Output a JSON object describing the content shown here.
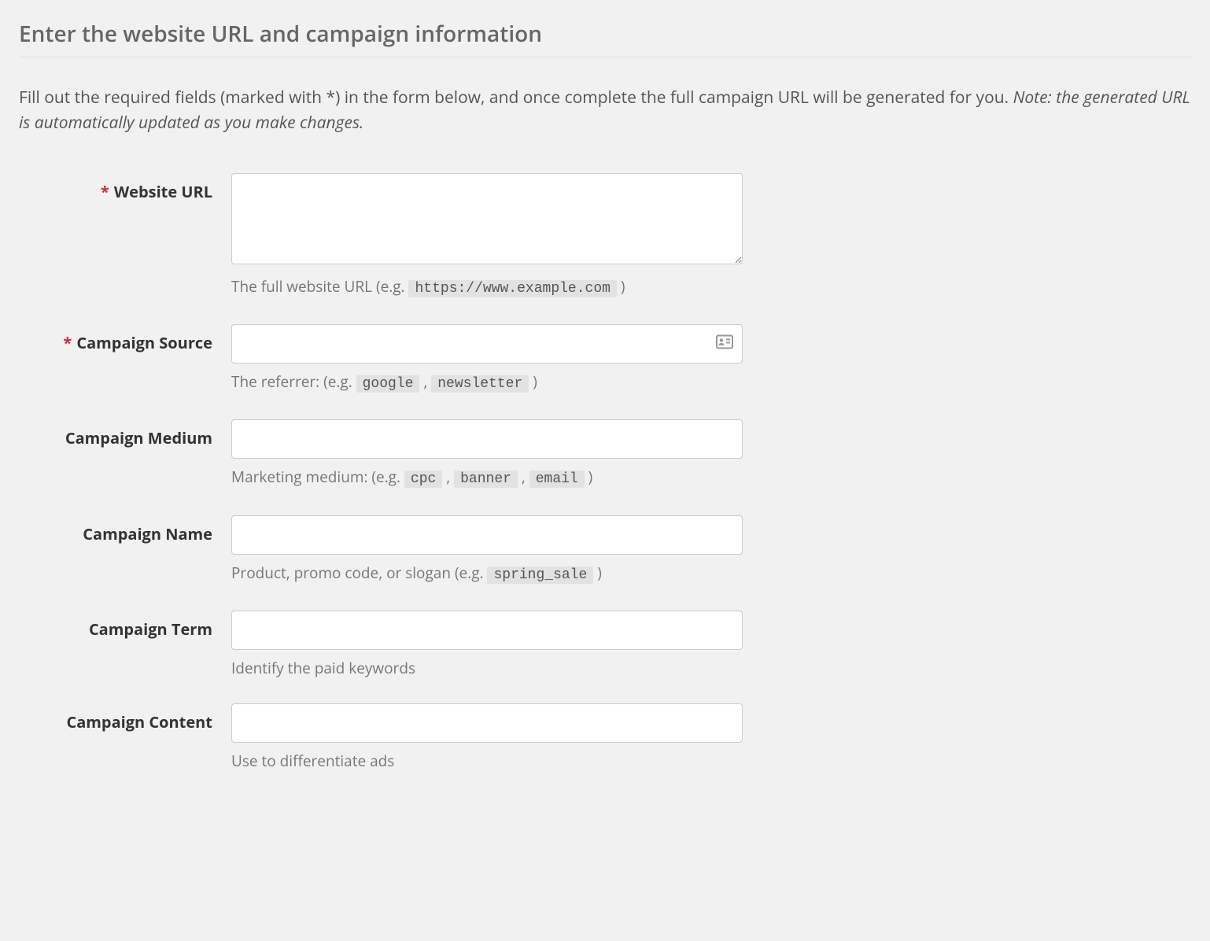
{
  "title": "Enter the website URL and campaign information",
  "intro": {
    "text": "Fill out the required fields (marked with *) in the form below, and once complete the full campaign URL will be generated for you. ",
    "note": "Note: the generated URL is automatically updated as you make changes."
  },
  "fields": {
    "website_url": {
      "label": "Website URL",
      "required": true,
      "helper_prefix": "The full website URL (e.g. ",
      "helper_code1": "https://www.example.com",
      "helper_suffix": " )"
    },
    "campaign_source": {
      "label": "Campaign Source",
      "required": true,
      "helper_prefix": "The referrer: (e.g. ",
      "helper_code1": "google",
      "helper_mid1": " , ",
      "helper_code2": "newsletter",
      "helper_suffix": " )"
    },
    "campaign_medium": {
      "label": "Campaign Medium",
      "required": false,
      "helper_prefix": "Marketing medium: (e.g. ",
      "helper_code1": "cpc",
      "helper_mid1": " , ",
      "helper_code2": "banner",
      "helper_mid2": " , ",
      "helper_code3": "email",
      "helper_suffix": " )"
    },
    "campaign_name": {
      "label": "Campaign Name",
      "required": false,
      "helper_prefix": "Product, promo code, or slogan (e.g. ",
      "helper_code1": "spring_sale",
      "helper_suffix": " )"
    },
    "campaign_term": {
      "label": "Campaign Term",
      "required": false,
      "helper_text": "Identify the paid keywords"
    },
    "campaign_content": {
      "label": "Campaign Content",
      "required": false,
      "helper_text": "Use to differentiate ads"
    }
  },
  "asterisk": "*"
}
